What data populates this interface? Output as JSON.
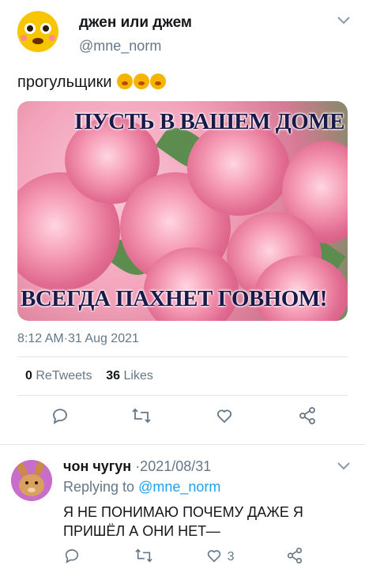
{
  "tweet": {
    "author_name": "джен или джем",
    "author_handle": "@mne_norm",
    "text": "прогульщики",
    "image": {
      "top_text": "ПУСТЬ В ВАШЕМ ДОМЕ",
      "bottom_text": "ВСЕГДА ПАХНЕТ ГОВНОМ!"
    },
    "timestamp": "8:12 AM·31 Aug 2021",
    "retweets_count": "0",
    "retweets_label": "ReTweets",
    "likes_count": "36",
    "likes_label": "Likes"
  },
  "reply": {
    "author_name": "чон чугун",
    "date": "·2021/08/31",
    "replying_prefix": "Replying to",
    "replying_handle": "@mne_norm",
    "text": "Я НЕ ПОНИМАЮ ПОЧЕМУ ДАЖЕ Я ПРИШЁЛ А ОНИ НЕТ—",
    "like_count": "3"
  },
  "icons": {
    "caret": "chevron-down-icon",
    "reply": "reply-icon",
    "retweet": "retweet-icon",
    "like": "heart-icon",
    "share": "share-icon"
  },
  "colors": {
    "link": "#1da1f2",
    "secondary_text": "#657786",
    "main_avatar_bg": "#f7c600",
    "reply_avatar_bg": "#c86dca"
  }
}
